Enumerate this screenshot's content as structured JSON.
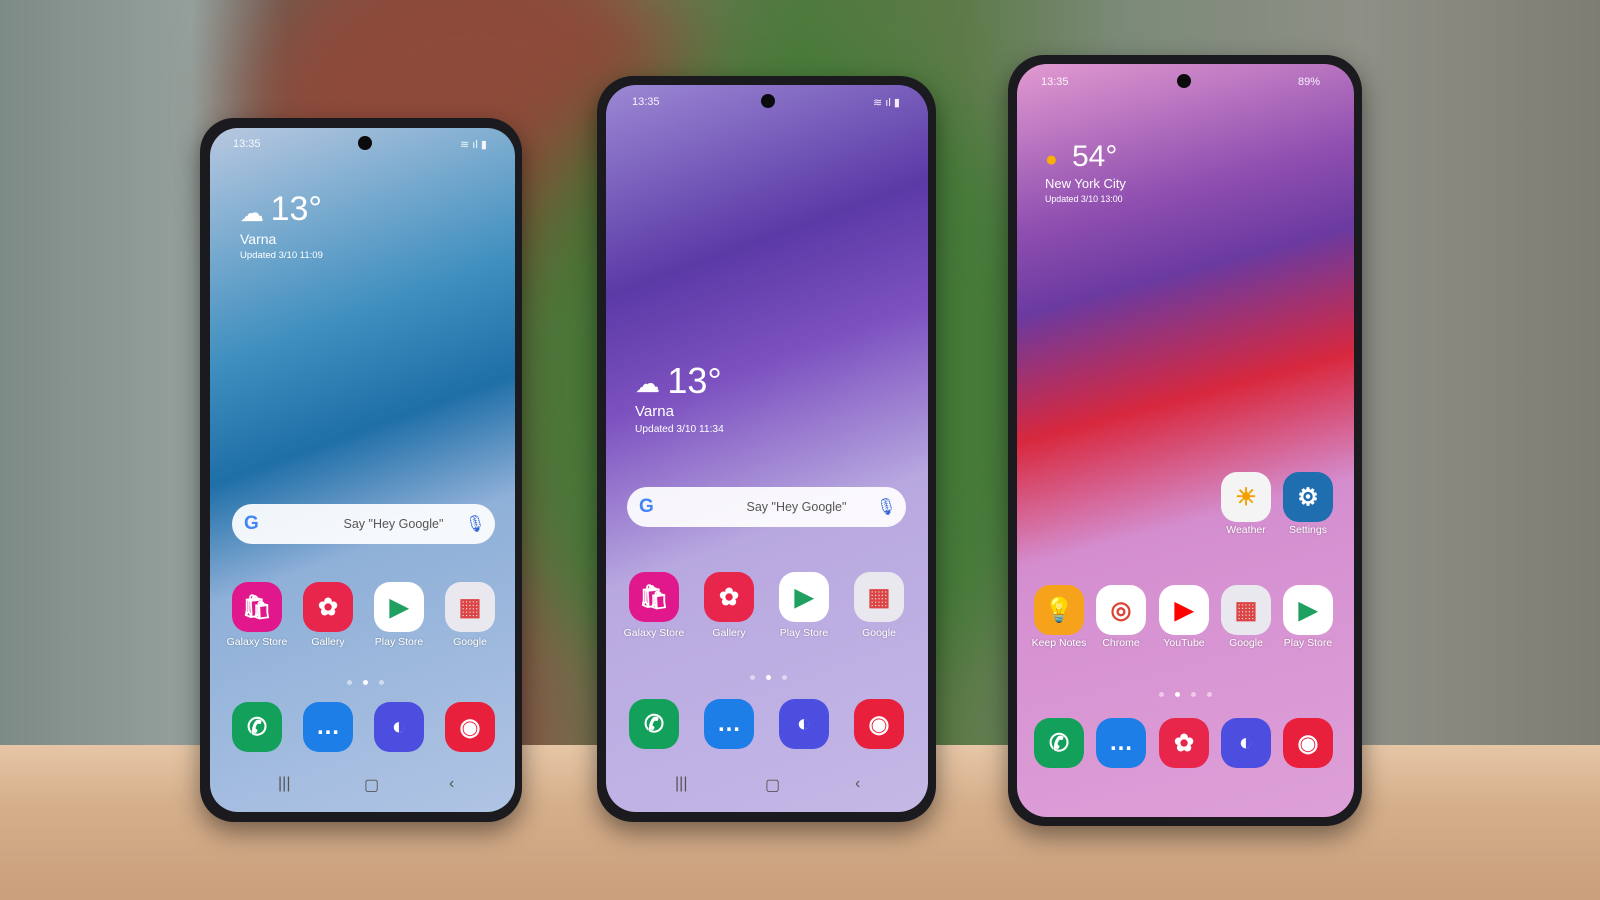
{
  "phones": [
    {
      "status_time": "13:35",
      "weather": {
        "temperature": "13°",
        "location": "Varna",
        "updated": "Updated 3/10 11:09",
        "icon": "cloud-icon"
      },
      "search": {
        "placeholder": "Say \"Hey Google\""
      },
      "apps": [
        {
          "label": "Galaxy Store",
          "icon": "galaxy-store-icon",
          "color": "#e0188c"
        },
        {
          "label": "Gallery",
          "icon": "gallery-icon",
          "color": "#e8254a"
        },
        {
          "label": "Play Store",
          "icon": "play-store-icon",
          "color": "#ffffff"
        },
        {
          "label": "Google",
          "icon": "google-folder-icon",
          "color": "#e8e8ee"
        }
      ],
      "dock": [
        {
          "icon": "phone-icon",
          "color": "#12a05a"
        },
        {
          "icon": "messages-icon",
          "color": "#1e7ee8"
        },
        {
          "icon": "internet-icon",
          "color": "#4c4ee0"
        },
        {
          "icon": "camera-icon",
          "color": "#e8203c"
        }
      ],
      "page_dots": 3,
      "active_page": 1
    },
    {
      "status_time": "13:35",
      "weather": {
        "temperature": "13°",
        "location": "Varna",
        "updated": "Updated 3/10 11:34",
        "icon": "cloud-icon"
      },
      "search": {
        "placeholder": "Say \"Hey Google\""
      },
      "apps": [
        {
          "label": "Galaxy Store",
          "icon": "galaxy-store-icon",
          "color": "#e0188c"
        },
        {
          "label": "Gallery",
          "icon": "gallery-icon",
          "color": "#e8254a"
        },
        {
          "label": "Play Store",
          "icon": "play-store-icon",
          "color": "#ffffff"
        },
        {
          "label": "Google",
          "icon": "google-folder-icon",
          "color": "#e8e8ee"
        }
      ],
      "dock": [
        {
          "icon": "phone-icon",
          "color": "#12a05a"
        },
        {
          "icon": "messages-icon",
          "color": "#1e7ee8"
        },
        {
          "icon": "internet-icon",
          "color": "#4c4ee0"
        },
        {
          "icon": "camera-icon",
          "color": "#e8203c"
        }
      ],
      "page_dots": 3,
      "active_page": 1
    },
    {
      "status_time": "13:35",
      "battery": "89%",
      "weather": {
        "temperature": "54°",
        "location": "New York City",
        "updated": "Updated 3/10 13:00",
        "icon": "sun-icon"
      },
      "apps": [
        {
          "label": "Weather",
          "icon": "weather-icon",
          "color": "#f4f4f4"
        },
        {
          "label": "Settings",
          "icon": "settings-icon",
          "color": "#1f6fb0"
        },
        {
          "label": "Keep Notes",
          "icon": "keep-notes-icon",
          "color": "#f6a21b"
        },
        {
          "label": "Chrome",
          "icon": "chrome-icon",
          "color": "#ffffff"
        },
        {
          "label": "YouTube",
          "icon": "youtube-icon",
          "color": "#ffffff"
        },
        {
          "label": "Google",
          "icon": "google-folder-icon",
          "color": "#e8e8ee"
        },
        {
          "label": "Play Store",
          "icon": "play-store-icon",
          "color": "#ffffff"
        }
      ],
      "dock": [
        {
          "icon": "phone-icon",
          "color": "#12a05a"
        },
        {
          "icon": "messages-icon",
          "color": "#1e7ee8"
        },
        {
          "icon": "gallery-icon",
          "color": "#e8254a"
        },
        {
          "icon": "internet-icon",
          "color": "#4c4ee0"
        },
        {
          "icon": "camera-icon",
          "color": "#e8203c"
        }
      ],
      "page_dots": 4,
      "active_page": 1
    }
  ]
}
